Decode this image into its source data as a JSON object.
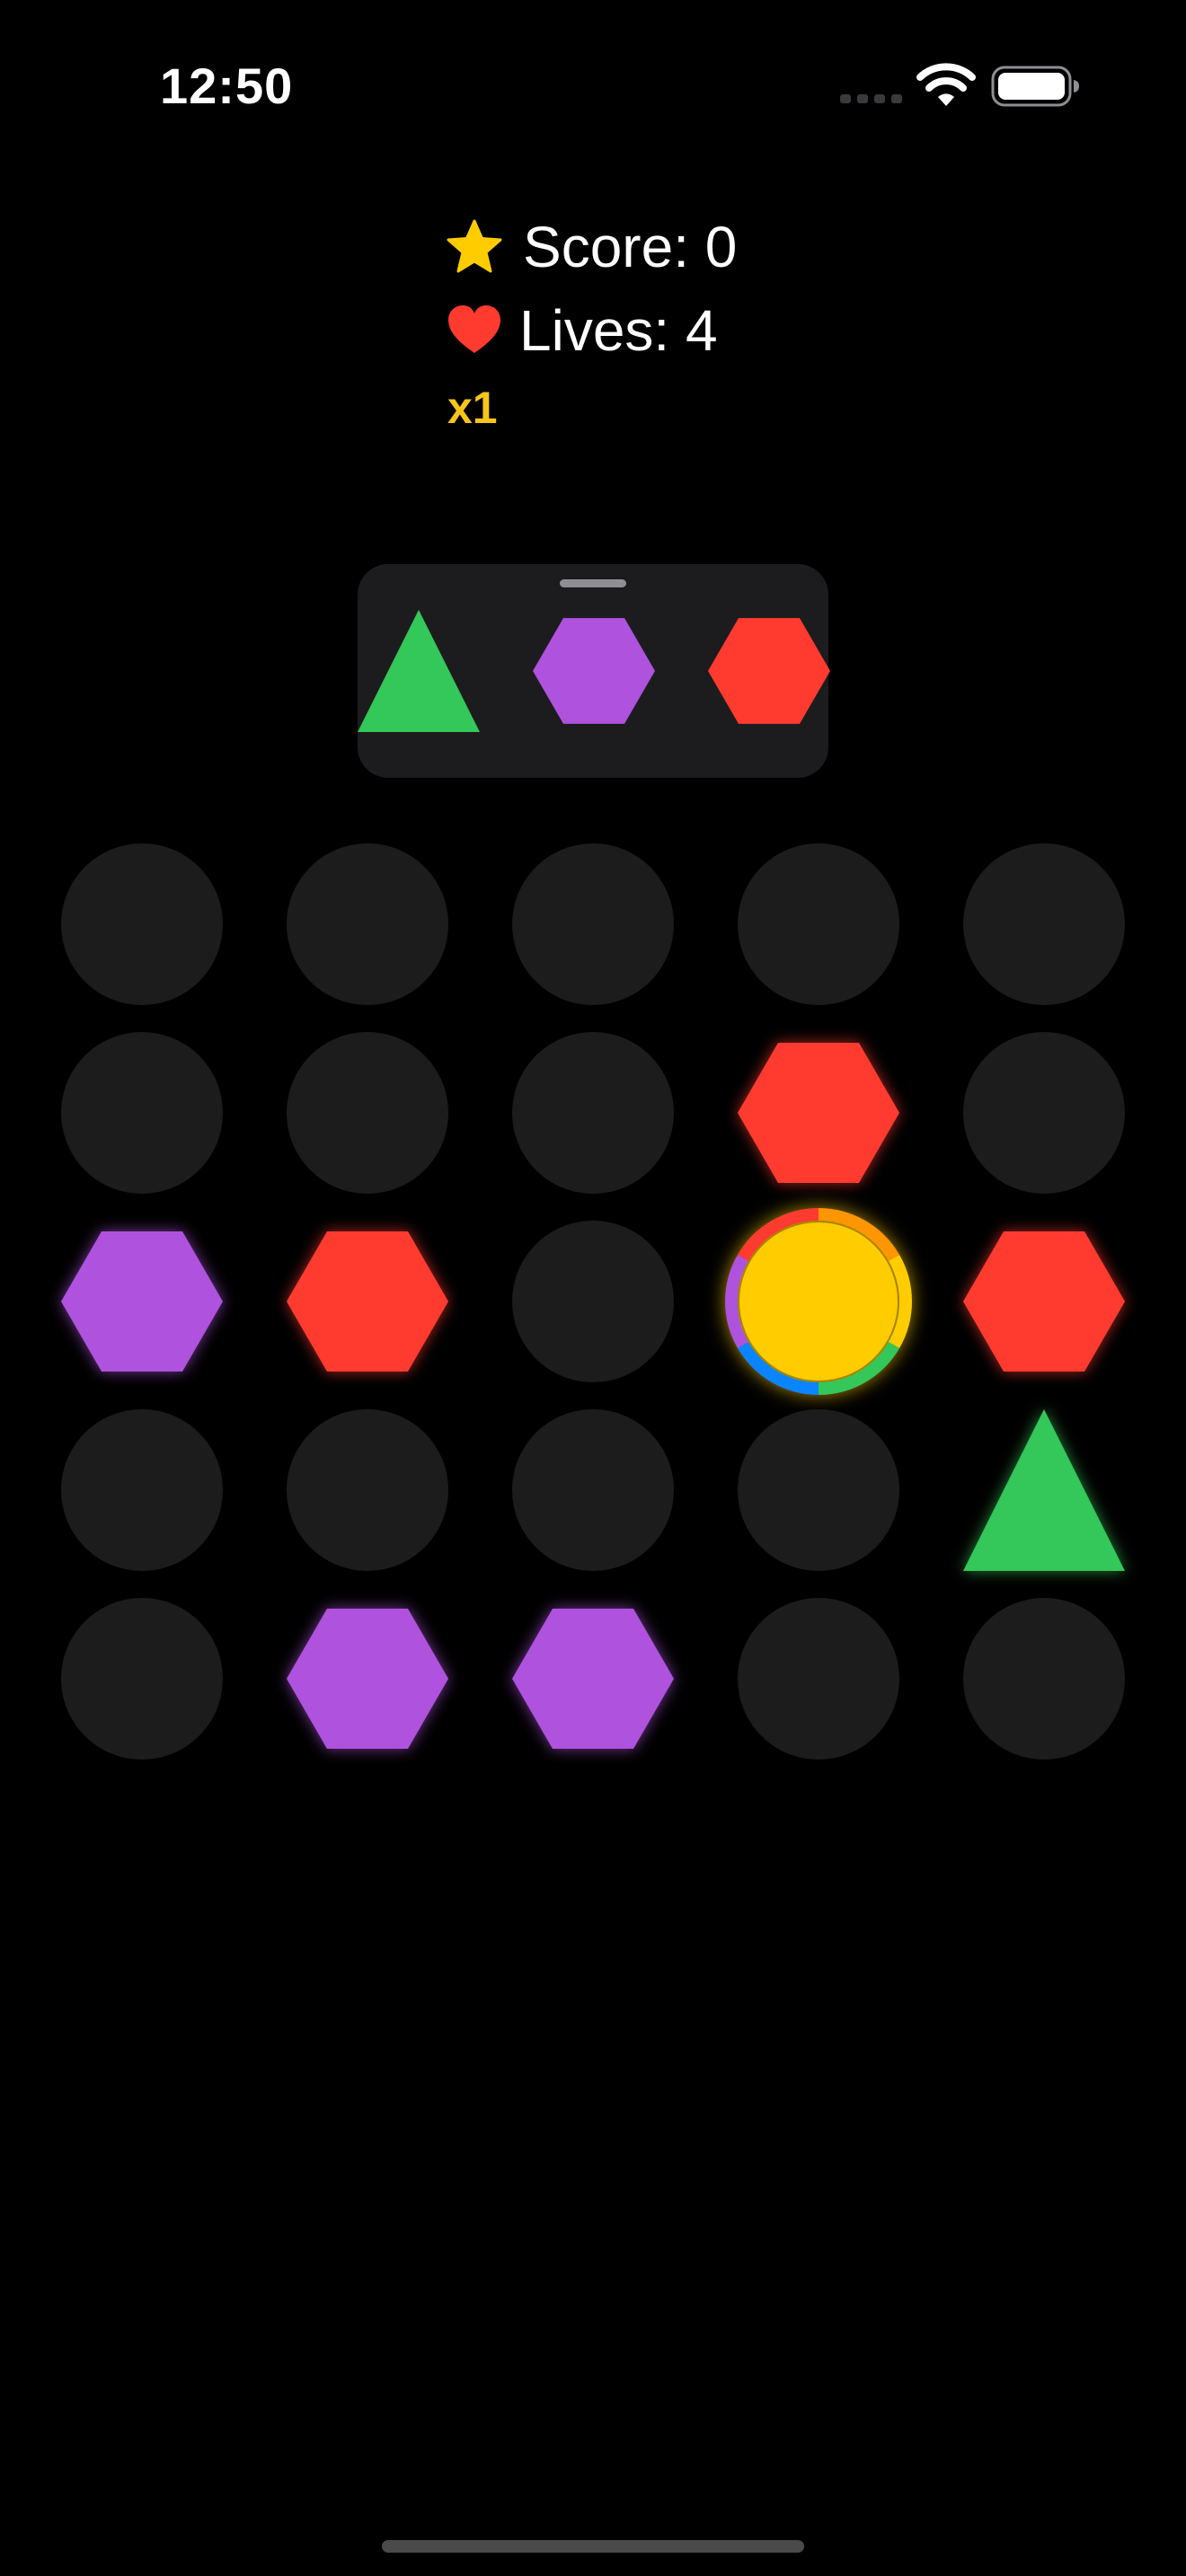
{
  "status_bar": {
    "time": "12:50",
    "icons": [
      "cellular-signal-icon",
      "wifi-icon",
      "battery-icon"
    ]
  },
  "hud": {
    "score_label": "Score: 0",
    "lives_label": "Lives: 4",
    "multiplier": "x1",
    "score_icon": "star-icon",
    "lives_icon": "heart-icon"
  },
  "colors": {
    "red": "#ff3b30",
    "purple": "#af52de",
    "green": "#34c759",
    "yellow": "#ffcc00",
    "blue": "#0a84ff",
    "orange": "#ff9500",
    "slot": "#1c1c1c",
    "tray": "#1c1c1e",
    "accent_gold": "#f5c518"
  },
  "next_pieces": [
    {
      "shape": "triangle",
      "color": "green"
    },
    {
      "shape": "hexagon",
      "color": "purple"
    },
    {
      "shape": "hexagon",
      "color": "red"
    }
  ],
  "board": {
    "rows": 5,
    "cols": 5,
    "cells": [
      [
        null,
        null,
        null,
        null,
        null
      ],
      [
        null,
        null,
        null,
        {
          "shape": "hexagon",
          "color": "red"
        },
        null
      ],
      [
        {
          "shape": "hexagon",
          "color": "purple"
        },
        {
          "shape": "hexagon",
          "color": "red"
        },
        null,
        {
          "shape": "wildcard-circle",
          "color": "yellow"
        },
        {
          "shape": "hexagon",
          "color": "red"
        }
      ],
      [
        null,
        null,
        null,
        null,
        {
          "shape": "triangle",
          "color": "green"
        }
      ],
      [
        null,
        {
          "shape": "hexagon",
          "color": "purple"
        },
        {
          "shape": "hexagon",
          "color": "purple"
        },
        null,
        null
      ]
    ]
  }
}
